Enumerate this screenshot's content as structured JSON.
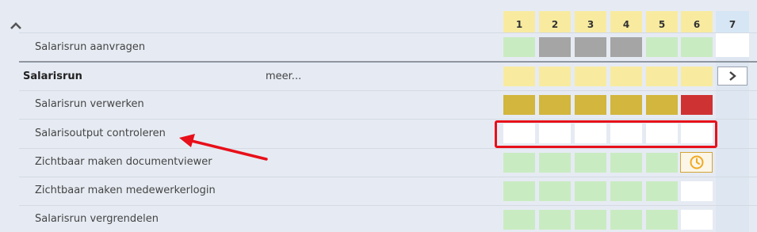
{
  "columns": [
    "1",
    "2",
    "3",
    "4",
    "5",
    "6",
    "7"
  ],
  "rows": [
    {
      "label": "Salarisrun aanvragen",
      "main": false,
      "cells": [
        "green",
        "gray",
        "gray",
        "gray",
        "green",
        "green",
        "empty"
      ]
    },
    {
      "label": "Salarisrun",
      "main": true,
      "link": "meer...",
      "cells": [
        "yellow",
        "yellow",
        "yellow",
        "yellow",
        "yellow",
        "yellow"
      ]
    },
    {
      "label": "Salarisrun verwerken",
      "main": false,
      "cells": [
        "gold",
        "gold",
        "gold",
        "gold",
        "gold",
        "red"
      ]
    },
    {
      "label": "Salarisoutput controleren",
      "main": false,
      "cells": [
        "empty",
        "empty",
        "empty",
        "empty",
        "empty",
        "empty"
      ]
    },
    {
      "label": "Zichtbaar maken documentviewer",
      "main": false,
      "cells": [
        "green",
        "green",
        "green",
        "green",
        "green",
        "clock-icon"
      ]
    },
    {
      "label": "Zichtbaar maken medewerkerlogin",
      "main": false,
      "cells": [
        "green",
        "green",
        "green",
        "green",
        "green",
        "empty"
      ]
    },
    {
      "label": "Salarisrun vergrendelen",
      "main": false,
      "cells": [
        "green",
        "green",
        "green",
        "green",
        "green",
        "empty"
      ]
    }
  ],
  "icons": {
    "collapse": "chevron-up-icon",
    "next": "chevron-right-icon",
    "status": "clock-icon"
  },
  "colors": {
    "background": "#e6ebf3",
    "green": "#c9ebc1",
    "gray": "#a5a5a5",
    "yellow": "#f8eba0",
    "gold": "#d2b63d",
    "red": "#cf3232",
    "today_header": "#d6e6f4",
    "annotation": "#e8101a"
  }
}
